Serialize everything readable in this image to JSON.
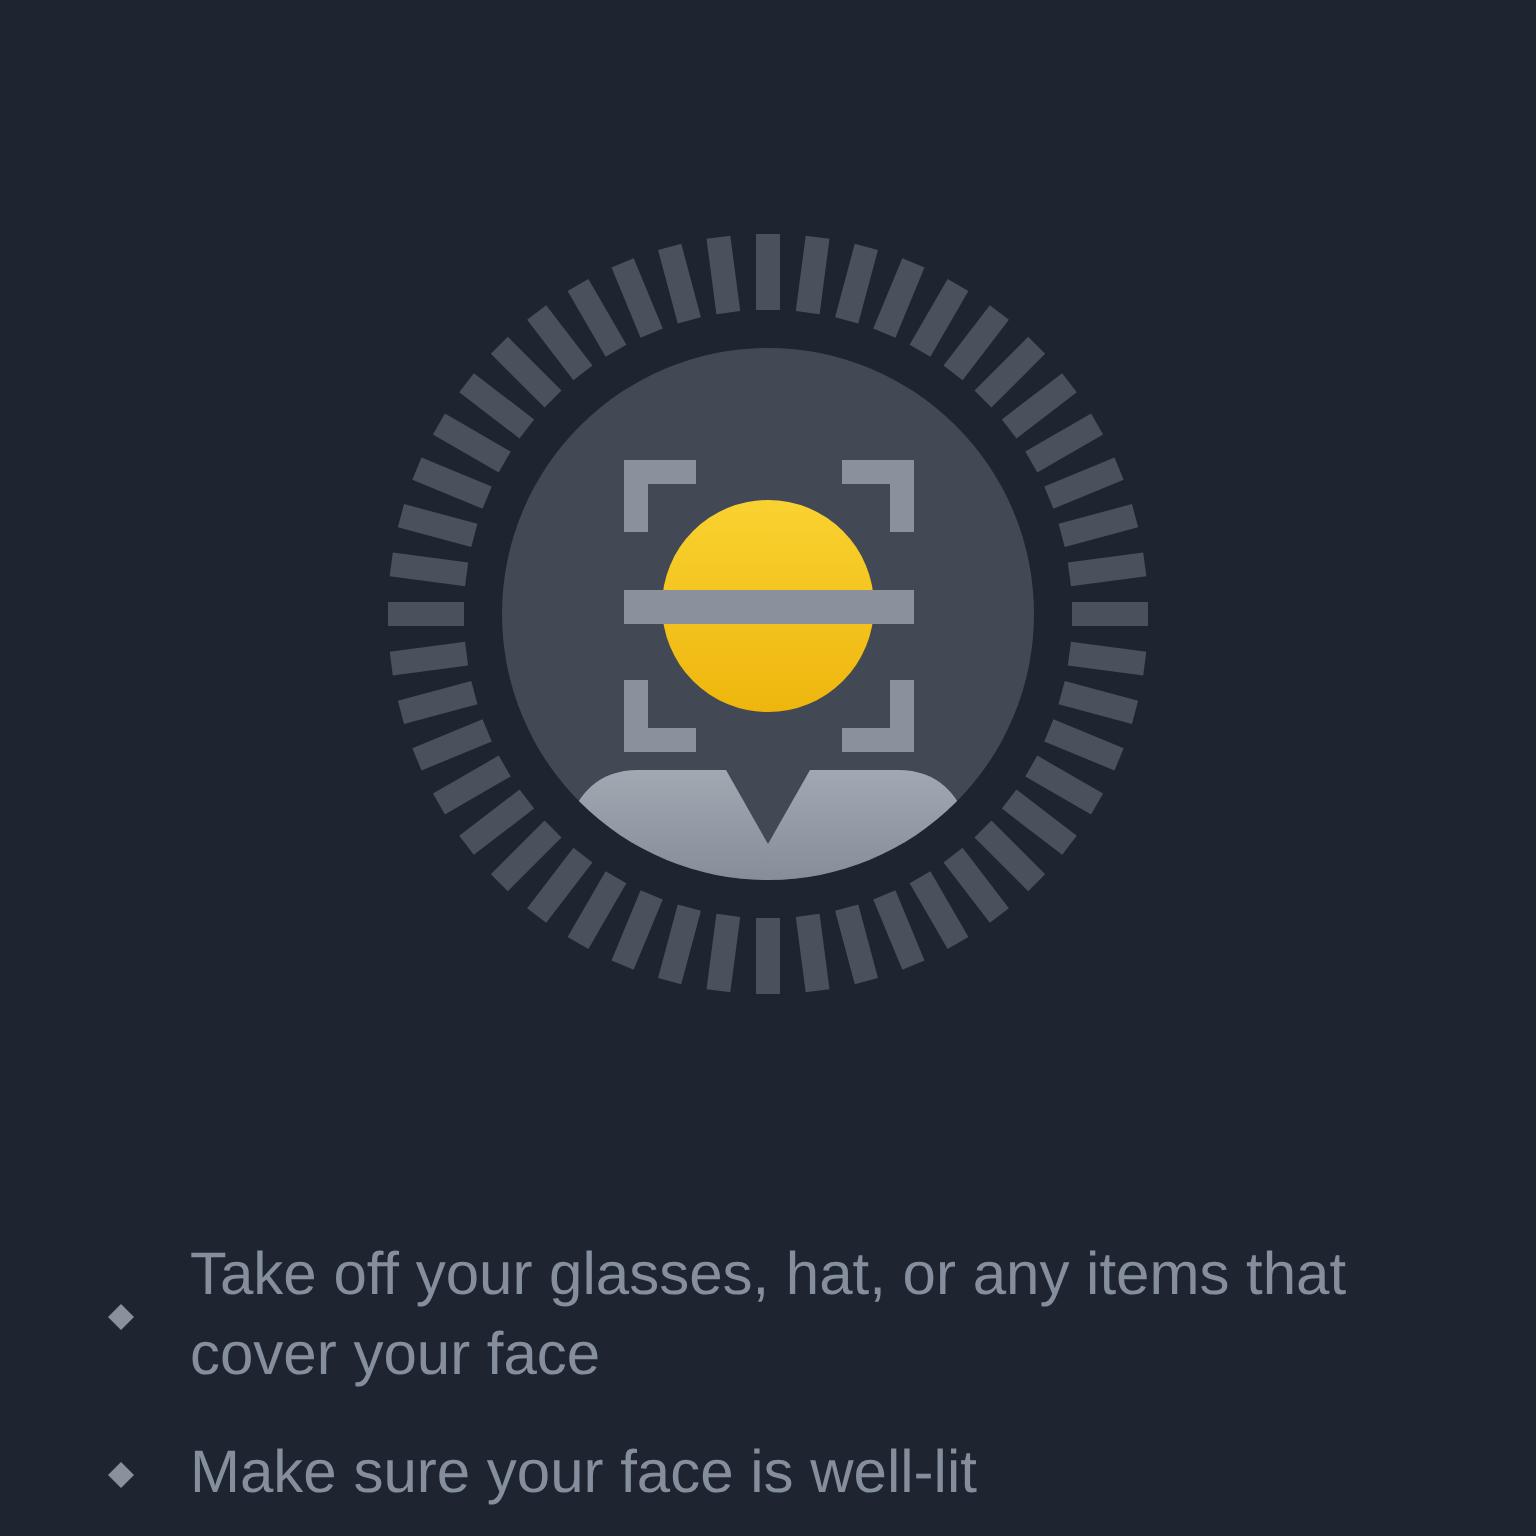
{
  "tips": [
    {
      "text": "Take off your glasses, hat, or any items that cover your face"
    },
    {
      "text": "Make sure your face is well-lit"
    }
  ]
}
